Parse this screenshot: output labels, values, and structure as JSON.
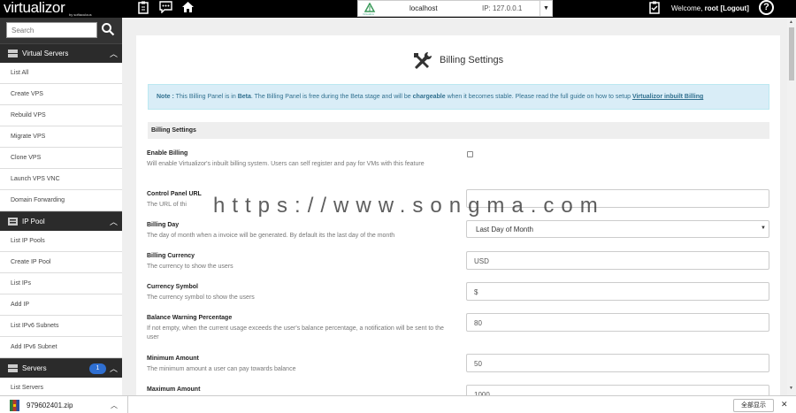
{
  "header": {
    "logo": "virtualizor",
    "logo_sub": "by softaculous",
    "server": {
      "logo_text": "Virtualizor",
      "host": "localhost",
      "ip": "IP: 127.0.0.1"
    },
    "welcome_prefix": "Welcome,",
    "user": "root",
    "logout": "[Logout]",
    "help_glyph": "?",
    "icons": [
      "clipboard-icon",
      "chat-icon",
      "home-icon",
      "task-list-icon",
      "help-icon"
    ]
  },
  "sidebar": {
    "search_placeholder": "Search",
    "sections": [
      {
        "title": "Virtual Servers",
        "icon": "server-icon",
        "items": [
          "List All",
          "Create VPS",
          "Rebuild VPS",
          "Migrate VPS",
          "Clone VPS",
          "Launch VPS VNC",
          "Domain Forwarding"
        ]
      },
      {
        "title": "IP Pool",
        "icon": "ip-pool-icon",
        "items": [
          "List IP Pools",
          "Create IP Pool",
          "List IPs",
          "Add IP",
          "List IPv6 Subnets",
          "Add IPv6 Subnet"
        ]
      },
      {
        "title": "Servers",
        "icon": "servers-icon",
        "badge": "1",
        "items": [
          "List Servers"
        ]
      }
    ]
  },
  "main": {
    "title": "Billing Settings",
    "note": {
      "label": "Note :",
      "t1": " This Billing Panel is in ",
      "beta": "Beta",
      "t2": ". The Billing Panel is free during the Beta stage and will be ",
      "chargeable": "chargeable",
      "t3": " when it becomes stable. Please read the full guide on how to setup ",
      "link": "Virtualizor inbuilt Billing"
    },
    "section_title": "Billing Settings",
    "fields": {
      "enable_billing": {
        "label": "Enable Billing",
        "desc": "Will enable Virtualizor's inbuilt billing system. Users can self register and pay for VMs with this feature",
        "checked": false
      },
      "control_panel_url": {
        "label": "Control Panel URL",
        "desc": "The URL of thi",
        "value": ""
      },
      "billing_day": {
        "label": "Billing Day",
        "desc": "The day of month when a invoice will be generated. By default its the last day of the month",
        "value": "Last Day of Month"
      },
      "billing_currency": {
        "label": "Billing Currency",
        "desc": "The currency to show the users",
        "value": "USD"
      },
      "currency_symbol": {
        "label": "Currency Symbol",
        "desc": "The currency symbol to show the users",
        "value": "$"
      },
      "balance_warning": {
        "label": "Balance Warning Percentage",
        "desc": "If not empty, when the current usage exceeds the user's balance percentage, a notification will be sent to the user",
        "value": "80"
      },
      "minimum_amount": {
        "label": "Minimum Amount",
        "desc": "The minimum amount a user can pay towards balance",
        "value": "50"
      },
      "maximum_amount": {
        "label": "Maximum Amount",
        "value": "1000"
      }
    }
  },
  "watermark": "https://www.songma.com",
  "download_bar": {
    "filename": "979602401.zip",
    "show_all": "全部显示"
  },
  "colors": {
    "topbar": "#000000",
    "sidebar_head": "#2b2b2b",
    "note_bg": "#d9edf7",
    "note_text": "#31708f",
    "badge": "#2f6fd1"
  }
}
